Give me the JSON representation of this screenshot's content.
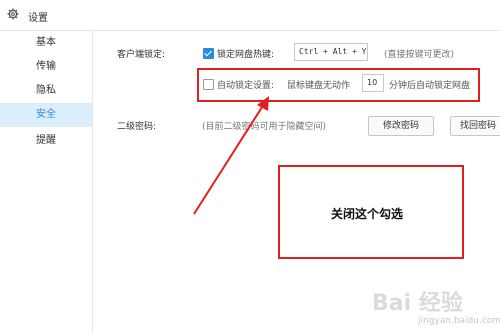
{
  "window": {
    "title": "设置",
    "icon": "gear-icon"
  },
  "sidebar": {
    "items": [
      {
        "label": "基本",
        "active": false
      },
      {
        "label": "传输",
        "active": false
      },
      {
        "label": "隐私",
        "active": false
      },
      {
        "label": "安全",
        "active": true
      },
      {
        "label": "提醒",
        "active": false
      }
    ]
  },
  "client_lock": {
    "label": "客户端锁定:",
    "hotkey_checkbox_label": "锁定网盘热键:",
    "hotkey_checked": true,
    "hotkey_value": "Ctrl + Alt + Y",
    "hotkey_hint": "(直接按键可更改)",
    "auto_lock_checkbox_label": "自动锁定设置:",
    "auto_lock_checked": false,
    "auto_lock_prefix": "鼠标键盘无动作",
    "auto_lock_minutes": "10",
    "auto_lock_suffix": "分钟后自动锁定网盘"
  },
  "second_password": {
    "label": "二级密码:",
    "hint": "(目前二级密码可用于隐藏空间)",
    "change_button": "修改密码",
    "recover_button": "找回密码"
  },
  "annotation": {
    "text": "关闭这个勾选",
    "color": "#e02020"
  },
  "watermark": {
    "main": "Bai 经验",
    "sub": "jingyan.baidu.com"
  }
}
